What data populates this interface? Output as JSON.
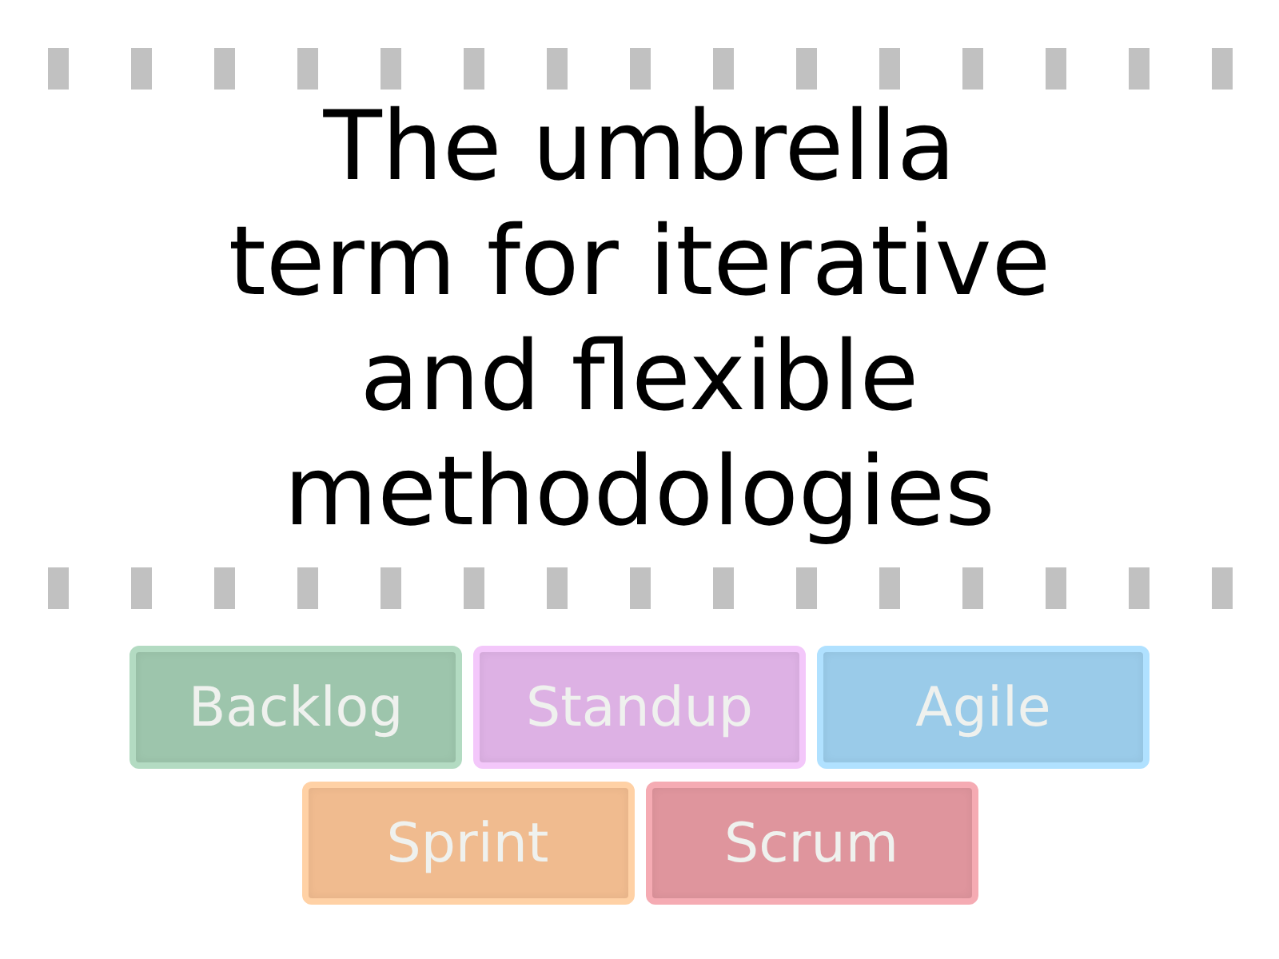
{
  "question": "The umbrella term for iterative and flexible methodologies",
  "answers": [
    {
      "label": "Backlog",
      "color": "#9dc5ac"
    },
    {
      "label": "Standup",
      "color": "#ddb1e4"
    },
    {
      "label": "Agile",
      "color": "#9acbe9"
    },
    {
      "label": "Sprint",
      "color": "#f0bb8f"
    },
    {
      "label": "Scrum",
      "color": "#df959d"
    }
  ]
}
